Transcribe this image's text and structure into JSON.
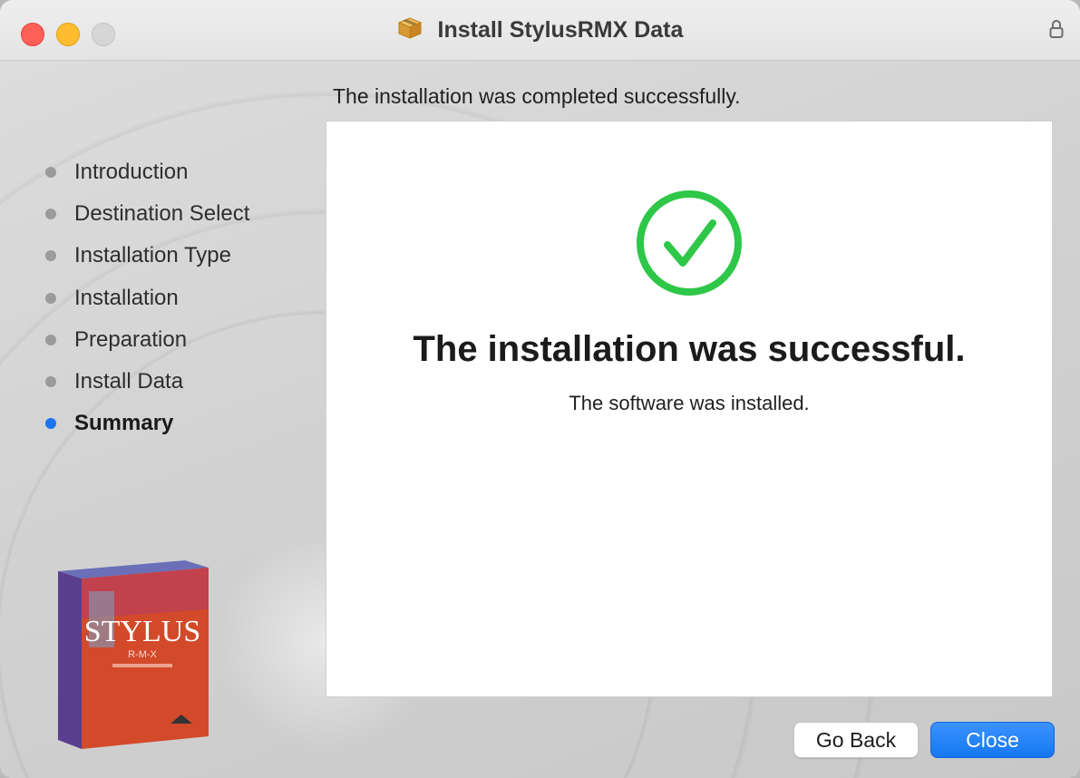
{
  "window": {
    "title": "Install StylusRMX Data",
    "icons": {
      "title": "package-icon",
      "lock": "lock-icon"
    }
  },
  "header": {
    "text": "The installation was completed successfully."
  },
  "sidebar": {
    "steps": [
      {
        "label": "Introduction",
        "active": false
      },
      {
        "label": "Destination Select",
        "active": false
      },
      {
        "label": "Installation Type",
        "active": false
      },
      {
        "label": "Installation",
        "active": false
      },
      {
        "label": "Preparation",
        "active": false
      },
      {
        "label": "Install Data",
        "active": false
      },
      {
        "label": "Summary",
        "active": true
      }
    ],
    "box_art": {
      "brand": "STYLUS",
      "subbrand": "R-M-X"
    }
  },
  "content": {
    "status_icon": "checkmark-circle-icon",
    "title": "The installation was successful.",
    "subtitle": "The software was installed."
  },
  "buttons": {
    "back_label": "Go Back",
    "close_label": "Close"
  },
  "colors": {
    "accent": "#1677f2",
    "success": "#2ec748",
    "close_red": "#fe5f57",
    "minimize_yellow": "#febc2e"
  }
}
